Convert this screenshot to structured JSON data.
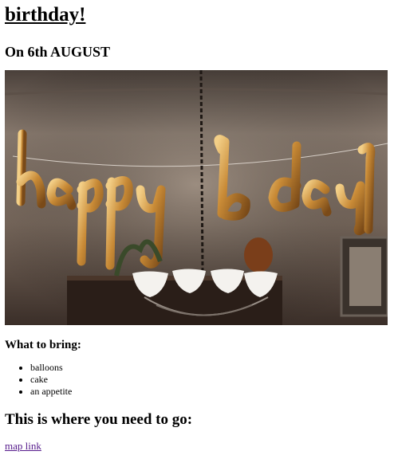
{
  "header": {
    "title": "birthday!",
    "date_line": "On 6th AUGUST"
  },
  "photo": {
    "subject": "happy b-day balloons",
    "balloon_color": "#c8903c",
    "wall_color": "#8a7a6c"
  },
  "bring": {
    "label": "What to bring:",
    "items": [
      "balloons",
      "cake",
      "an appetite"
    ]
  },
  "destination": {
    "heading": "This is where you need to go:",
    "link_label": "map link"
  }
}
